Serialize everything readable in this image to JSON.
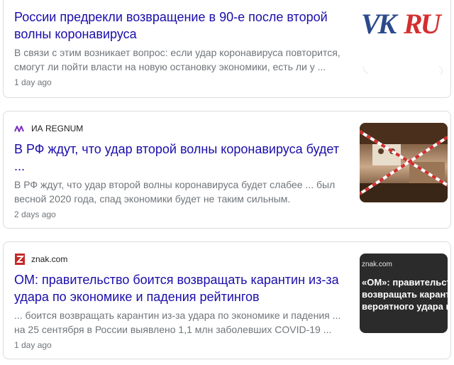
{
  "results": [
    {
      "source": "",
      "title_lines": [
        "России предрекли возвращение в 90-е после второй",
        "волны коронавируса"
      ],
      "snippet_lines": [
        "В связи с этим возникает вопрос: если удар коронавируса повторится,",
        "смогут ли пойти власти на новую остановку экономики, есть ли у ..."
      ],
      "age": "1 day ago",
      "thumb_logo": "VKRU"
    },
    {
      "source": "ИА REGNUM",
      "title_lines": [
        "В РФ ждут, что удар второй волны коронавируса будет",
        "..."
      ],
      "snippet_lines": [
        "В РФ ждут, что удар второй волны коронавируса будет слабее ... был",
        "весной 2020 года, спад экономики будет не таким сильным."
      ],
      "age": "2 days ago"
    },
    {
      "source": "znak.com",
      "title_lines": [
        "ОМ: правительство боится возвращать карантин из-за",
        "удара по экономике и падения рейтингов"
      ],
      "snippet_lines": [
        "... боится возвращать карантин из-за удара по экономике и падения ...",
        "на 25 сентября в России выявлено 1,1 млн заболевших COVID-19 ..."
      ],
      "age": "1 day ago",
      "thumb_caption": "znak.com",
      "thumb_text_lines": [
        "«ОМ»: правительство",
        "возвращать карантин",
        "вероятного удара по э"
      ]
    }
  ],
  "colors": {
    "title": "#1a0dab",
    "snippet": "#70757a",
    "border": "#dadce0",
    "regnum": "#7b2fbf",
    "znak": "#c62828"
  },
  "icons": [
    "regnum-logo-icon",
    "znak-logo-icon"
  ]
}
